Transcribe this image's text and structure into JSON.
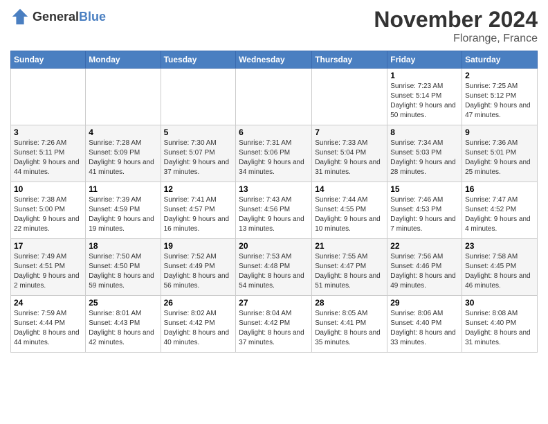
{
  "header": {
    "logo_general": "General",
    "logo_blue": "Blue",
    "month_title": "November 2024",
    "location": "Florange, France"
  },
  "days_of_week": [
    "Sunday",
    "Monday",
    "Tuesday",
    "Wednesday",
    "Thursday",
    "Friday",
    "Saturday"
  ],
  "weeks": [
    {
      "days": [
        {
          "num": "",
          "info": ""
        },
        {
          "num": "",
          "info": ""
        },
        {
          "num": "",
          "info": ""
        },
        {
          "num": "",
          "info": ""
        },
        {
          "num": "",
          "info": ""
        },
        {
          "num": "1",
          "info": "Sunrise: 7:23 AM\nSunset: 5:14 PM\nDaylight: 9 hours and 50 minutes."
        },
        {
          "num": "2",
          "info": "Sunrise: 7:25 AM\nSunset: 5:12 PM\nDaylight: 9 hours and 47 minutes."
        }
      ]
    },
    {
      "days": [
        {
          "num": "3",
          "info": "Sunrise: 7:26 AM\nSunset: 5:11 PM\nDaylight: 9 hours and 44 minutes."
        },
        {
          "num": "4",
          "info": "Sunrise: 7:28 AM\nSunset: 5:09 PM\nDaylight: 9 hours and 41 minutes."
        },
        {
          "num": "5",
          "info": "Sunrise: 7:30 AM\nSunset: 5:07 PM\nDaylight: 9 hours and 37 minutes."
        },
        {
          "num": "6",
          "info": "Sunrise: 7:31 AM\nSunset: 5:06 PM\nDaylight: 9 hours and 34 minutes."
        },
        {
          "num": "7",
          "info": "Sunrise: 7:33 AM\nSunset: 5:04 PM\nDaylight: 9 hours and 31 minutes."
        },
        {
          "num": "8",
          "info": "Sunrise: 7:34 AM\nSunset: 5:03 PM\nDaylight: 9 hours and 28 minutes."
        },
        {
          "num": "9",
          "info": "Sunrise: 7:36 AM\nSunset: 5:01 PM\nDaylight: 9 hours and 25 minutes."
        }
      ]
    },
    {
      "days": [
        {
          "num": "10",
          "info": "Sunrise: 7:38 AM\nSunset: 5:00 PM\nDaylight: 9 hours and 22 minutes."
        },
        {
          "num": "11",
          "info": "Sunrise: 7:39 AM\nSunset: 4:59 PM\nDaylight: 9 hours and 19 minutes."
        },
        {
          "num": "12",
          "info": "Sunrise: 7:41 AM\nSunset: 4:57 PM\nDaylight: 9 hours and 16 minutes."
        },
        {
          "num": "13",
          "info": "Sunrise: 7:43 AM\nSunset: 4:56 PM\nDaylight: 9 hours and 13 minutes."
        },
        {
          "num": "14",
          "info": "Sunrise: 7:44 AM\nSunset: 4:55 PM\nDaylight: 9 hours and 10 minutes."
        },
        {
          "num": "15",
          "info": "Sunrise: 7:46 AM\nSunset: 4:53 PM\nDaylight: 9 hours and 7 minutes."
        },
        {
          "num": "16",
          "info": "Sunrise: 7:47 AM\nSunset: 4:52 PM\nDaylight: 9 hours and 4 minutes."
        }
      ]
    },
    {
      "days": [
        {
          "num": "17",
          "info": "Sunrise: 7:49 AM\nSunset: 4:51 PM\nDaylight: 9 hours and 2 minutes."
        },
        {
          "num": "18",
          "info": "Sunrise: 7:50 AM\nSunset: 4:50 PM\nDaylight: 8 hours and 59 minutes."
        },
        {
          "num": "19",
          "info": "Sunrise: 7:52 AM\nSunset: 4:49 PM\nDaylight: 8 hours and 56 minutes."
        },
        {
          "num": "20",
          "info": "Sunrise: 7:53 AM\nSunset: 4:48 PM\nDaylight: 8 hours and 54 minutes."
        },
        {
          "num": "21",
          "info": "Sunrise: 7:55 AM\nSunset: 4:47 PM\nDaylight: 8 hours and 51 minutes."
        },
        {
          "num": "22",
          "info": "Sunrise: 7:56 AM\nSunset: 4:46 PM\nDaylight: 8 hours and 49 minutes."
        },
        {
          "num": "23",
          "info": "Sunrise: 7:58 AM\nSunset: 4:45 PM\nDaylight: 8 hours and 46 minutes."
        }
      ]
    },
    {
      "days": [
        {
          "num": "24",
          "info": "Sunrise: 7:59 AM\nSunset: 4:44 PM\nDaylight: 8 hours and 44 minutes."
        },
        {
          "num": "25",
          "info": "Sunrise: 8:01 AM\nSunset: 4:43 PM\nDaylight: 8 hours and 42 minutes."
        },
        {
          "num": "26",
          "info": "Sunrise: 8:02 AM\nSunset: 4:42 PM\nDaylight: 8 hours and 40 minutes."
        },
        {
          "num": "27",
          "info": "Sunrise: 8:04 AM\nSunset: 4:42 PM\nDaylight: 8 hours and 37 minutes."
        },
        {
          "num": "28",
          "info": "Sunrise: 8:05 AM\nSunset: 4:41 PM\nDaylight: 8 hours and 35 minutes."
        },
        {
          "num": "29",
          "info": "Sunrise: 8:06 AM\nSunset: 4:40 PM\nDaylight: 8 hours and 33 minutes."
        },
        {
          "num": "30",
          "info": "Sunrise: 8:08 AM\nSunset: 4:40 PM\nDaylight: 8 hours and 31 minutes."
        }
      ]
    }
  ]
}
